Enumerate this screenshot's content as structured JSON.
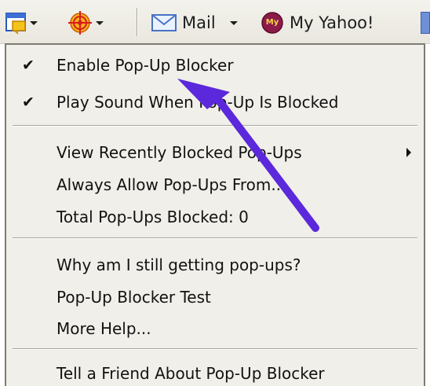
{
  "toolbar": {
    "mail_label": "Mail",
    "my_yahoo_label": "My Yahoo!",
    "my_yahoo_badge": "My"
  },
  "menu": {
    "enable_blocker": "Enable Pop-Up Blocker",
    "play_sound": "Play Sound When Pop-Up Is Blocked",
    "view_recent": "View Recently Blocked Pop-Ups",
    "always_allow": "Always Allow Pop-Ups From...",
    "total_blocked": "Total Pop-Ups Blocked: 0",
    "why_still": "Why am I still getting pop-ups?",
    "blocker_test": "Pop-Up Blocker Test",
    "more_help": "More Help...",
    "tell_friend": "Tell a Friend About Pop-Up Blocker"
  },
  "checks": {
    "enable_blocker": true,
    "play_sound": true
  },
  "colors": {
    "annotation_arrow": "#5b28dc",
    "menu_background": "#f0efe9"
  },
  "icons": {
    "popup_blocker": "popup-window-icon",
    "spyware": "target-crosshair-icon",
    "mail": "envelope-icon",
    "my_yahoo": "my-yahoo-badge-icon"
  }
}
